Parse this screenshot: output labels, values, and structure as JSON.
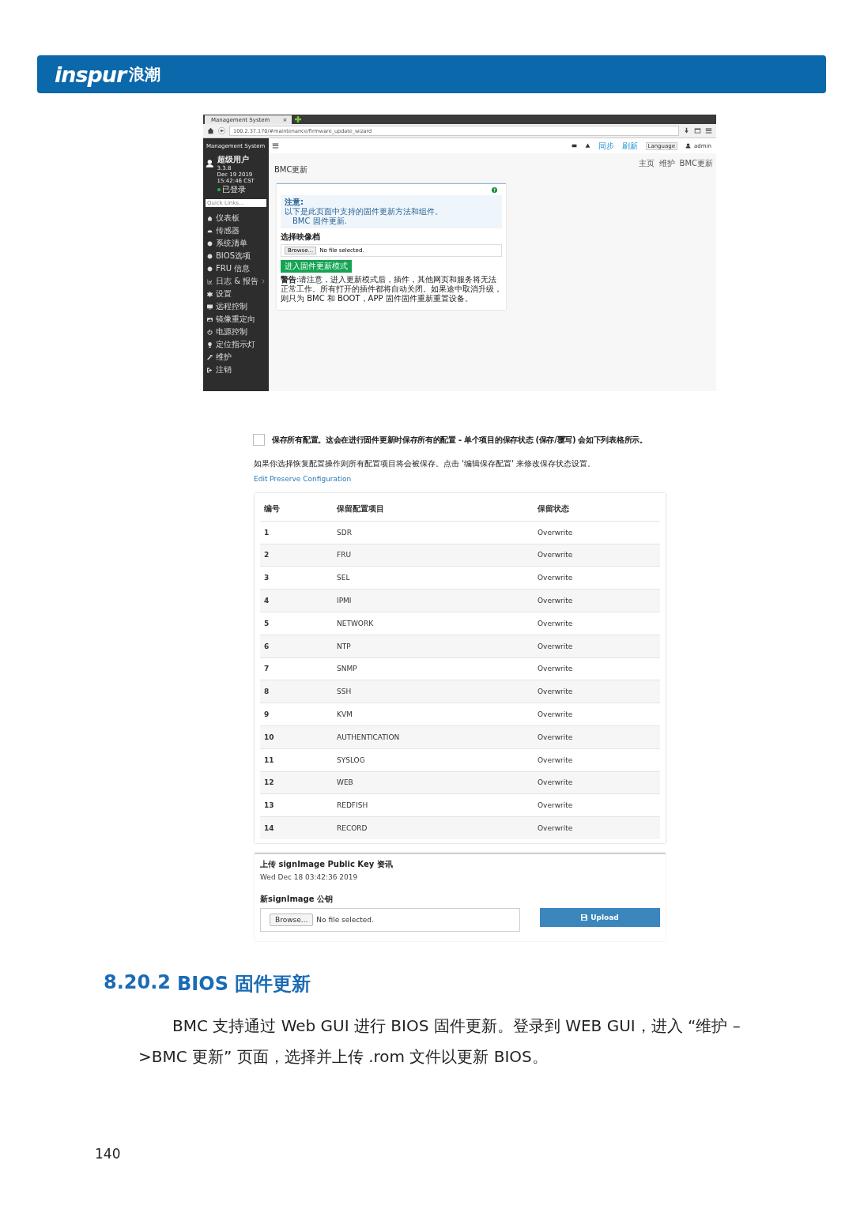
{
  "header": {
    "logo_latin": "inspur",
    "logo_cjk": "浪潮"
  },
  "screenshot_1": {
    "browser": {
      "tab": "Management System",
      "tab_close": "×",
      "url": "100.2.37.170/#maintenance/firmware_update_wizard"
    },
    "sidebar": {
      "title": "Management System",
      "user": {
        "name": "超级用户",
        "version": "3.3.8",
        "date": "Dec 19 2019 15:42:46 CST",
        "status": "已登录"
      },
      "quick_links": {
        "placeholder": "Quick Links..."
      },
      "items": [
        {
          "label": "仪表板",
          "expandable": false
        },
        {
          "label": "传感器",
          "expandable": false
        },
        {
          "label": "系统清单",
          "expandable": false
        },
        {
          "label": "BIOS选项",
          "expandable": false
        },
        {
          "label": "FRU 信息",
          "expandable": false
        },
        {
          "label": "日志 & 报告",
          "expandable": true
        },
        {
          "label": "设置",
          "expandable": false
        },
        {
          "label": "远程控制",
          "expandable": false
        },
        {
          "label": "镜像重定向",
          "expandable": false
        },
        {
          "label": "电源控制",
          "expandable": false
        },
        {
          "label": "定位指示灯",
          "expandable": false
        },
        {
          "label": "维护",
          "expandable": false
        },
        {
          "label": "注销",
          "expandable": false
        }
      ]
    },
    "topbar": {
      "sync": "同步",
      "refresh": "刷新",
      "language": "Language",
      "user": "admin"
    },
    "page_title": "BMC更新",
    "breadcrumb": [
      "主页",
      "维护",
      "BMC更新"
    ],
    "note": {
      "title": "注意:",
      "text": "以下是此页面中支持的固件更新方法和组件。",
      "bullet": "BMC 固件更新."
    },
    "file_label": "选择映像档",
    "browse": "Browse...",
    "no_file": "No file selected.",
    "enter_button": "进入固件更新模式",
    "warning": "**警告**:请注意，进入更新模式后，插件，其他网页和服务将无法正常工作。所有打开的插件都将自动关闭。如果途中取消升级，则只为 BMC 和 BOOT，APP 固件固件重新重置设备。"
  },
  "screenshot_2": {
    "preserve_all": {
      "checked": false,
      "label": "保存所有配置。这会在进行固件更新时保存所有的配置 - 单个项目的保存状态 (保存/覆写) 会如下列表格所示。"
    },
    "info": "如果你选择恢复配置操作则所有配置项目将会被保存。点击 '编辑保存配置' 来修改保存状态设置。",
    "link": "Edit Preserve Configuration",
    "table": {
      "columns": [
        "编号",
        "保留配置项目",
        "保留状态"
      ],
      "rows": [
        [
          "1",
          "SDR",
          "Overwrite"
        ],
        [
          "2",
          "FRU",
          "Overwrite"
        ],
        [
          "3",
          "SEL",
          "Overwrite"
        ],
        [
          "4",
          "IPMI",
          "Overwrite"
        ],
        [
          "5",
          "NETWORK",
          "Overwrite"
        ],
        [
          "6",
          "NTP",
          "Overwrite"
        ],
        [
          "7",
          "SNMP",
          "Overwrite"
        ],
        [
          "8",
          "SSH",
          "Overwrite"
        ],
        [
          "9",
          "KVM",
          "Overwrite"
        ],
        [
          "10",
          "AUTHENTICATION",
          "Overwrite"
        ],
        [
          "11",
          "SYSLOG",
          "Overwrite"
        ],
        [
          "12",
          "WEB",
          "Overwrite"
        ],
        [
          "13",
          "REDFISH",
          "Overwrite"
        ],
        [
          "14",
          "RECORD",
          "Overwrite"
        ]
      ]
    },
    "upload": {
      "title": "上传 signImage Public Key 资讯",
      "date": "Wed Dec 18 03:42:36 2019",
      "field_label": "新signImage 公钥",
      "browse": "Browse...",
      "no_file": "No file selected.",
      "button": "Upload"
    }
  },
  "section": {
    "number": "8.20.2",
    "title": "BIOS 固件更新",
    "body": "BMC 支持通过 Web GUI 进行 BIOS 固件更新。登录到 WEB GUI，进入 “维护 –>BMC 更新” 页面，选择并上传 .rom 文件以更新 BIOS。"
  },
  "page_number": "140"
}
